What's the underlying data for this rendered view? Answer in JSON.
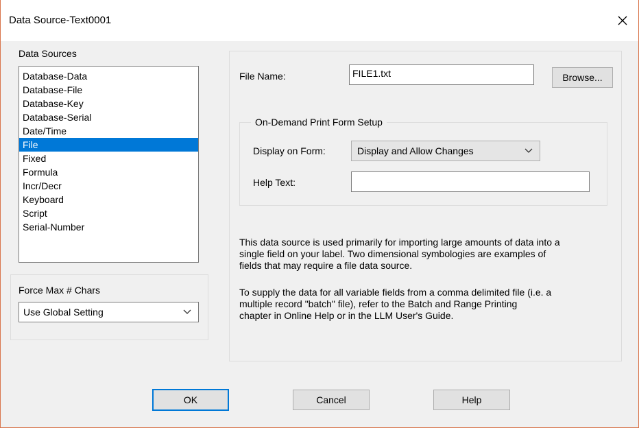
{
  "window": {
    "title": "Data Source-Text0001",
    "close_glyph": "✕"
  },
  "data_sources": {
    "label": "Data Sources",
    "items": [
      "Database-Data",
      "Database-File",
      "Database-Key",
      "Database-Serial",
      "Date/Time",
      "File",
      "Fixed",
      "Formula",
      "Incr/Decr",
      "Keyboard",
      "Script",
      "Serial-Number"
    ],
    "selected": "File"
  },
  "force_max": {
    "label": "Force Max # Chars",
    "value": "Use Global Setting"
  },
  "file": {
    "label": "File Name:",
    "value": "FILE1.txt",
    "browse_label": "Browse..."
  },
  "on_demand": {
    "group_label": "On-Demand Print Form Setup",
    "display_label": "Display on Form:",
    "display_value": "Display and Allow Changes",
    "help_label": "Help Text:",
    "help_value": ""
  },
  "description": {
    "para1_lines": [
      "This data source is used primarily for importing large amounts of data into a",
      "single field on your label.  Two dimensional symbologies are examples of",
      "fields that may require a file data source."
    ],
    "para2_lines": [
      "To supply the data for all variable fields from a comma delimited file (i.e. a",
      "multiple record \"batch\" file), refer to  the Batch and Range Printing",
      "chapter in Online Help or in the LLM User's Guide."
    ]
  },
  "buttons": {
    "ok": "OK",
    "cancel": "Cancel",
    "help": "Help"
  },
  "colors": {
    "selection": "#0078d7",
    "window_border": "#d8734a"
  }
}
